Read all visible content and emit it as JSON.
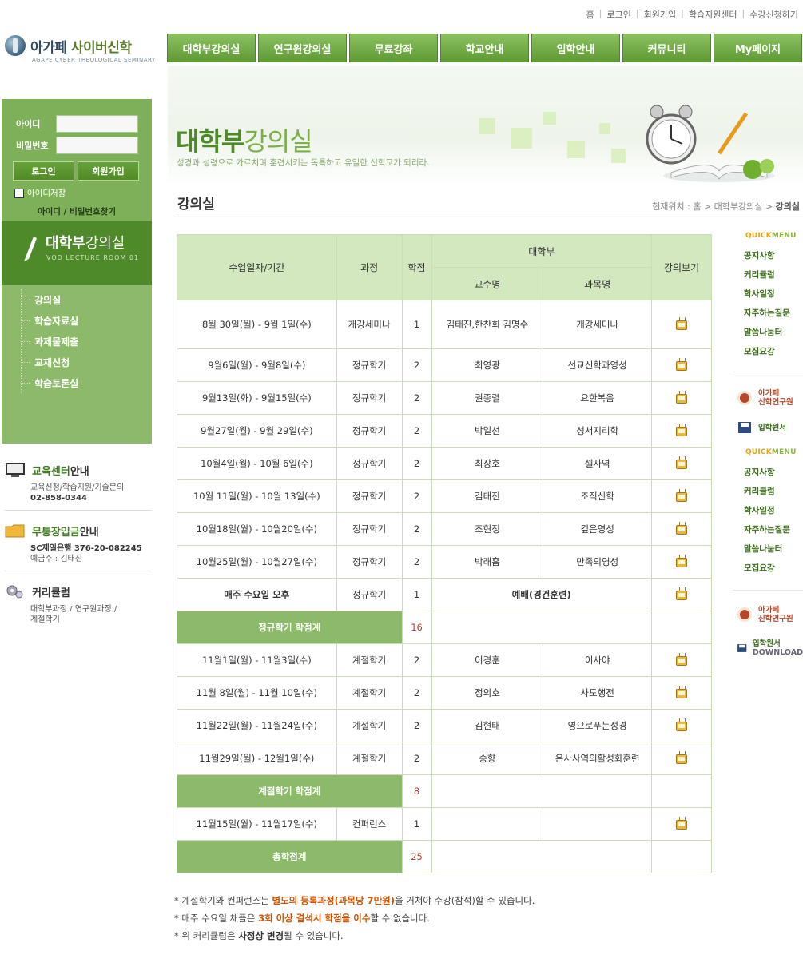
{
  "top_links": [
    "홈",
    "로그인",
    "회원가입",
    "학습지원센터",
    "수강신청하기"
  ],
  "logo": {
    "name_a": "아가페",
    "name_b": "사이버신학",
    "sub": "AGAPE CYBER THEOLOGICAL SEMINARY"
  },
  "gnb": [
    "대학부강의실",
    "연구원강의실",
    "무료강좌",
    "학교안내",
    "입학안내",
    "커뮤니티",
    "My페이지"
  ],
  "banner": {
    "title_bold": "대학부",
    "title_rest": "강의실",
    "subtitle": "성경과 성령으로 가르치며 훈련시키는 독특하고 유일한 신학교가 되리라."
  },
  "section": {
    "title": "강의실",
    "breadcrumb_prefix": "현재위치 : 홈 > 대학부강의실 > ",
    "breadcrumb_current": "강의실"
  },
  "login": {
    "id_label": "아이디",
    "pw_label": "비밀번호",
    "login_btn": "로그인",
    "join_btn": "회원가입",
    "save_id": "아이디저장",
    "find": "아이디 / 비밀번호찾기"
  },
  "vod": {
    "title_bold": "대학부",
    "title_rest": "강의실",
    "sub": "VOD LECTURE ROOM 01"
  },
  "left_menu": [
    "강의실",
    "학습자료실",
    "과제물제출",
    "교재신청",
    "학습토론실"
  ],
  "info": {
    "edu_head_bold": "교육센터",
    "edu_head_rest": "안내",
    "edu_desc": "교육신청/학습지원/기술문의",
    "edu_phone": "02-858-0344",
    "bank_head_bold": "무통장입금",
    "bank_head_rest": "안내",
    "bank_acct": "SC제일은행 376-20-082245",
    "bank_owner": "예금주 : 김태진",
    "curr_head": "커리큘럼",
    "curr_desc1": "대학부과정 / 연구원과정 /",
    "curr_desc2": "계절학기"
  },
  "quick": {
    "head_a": "QUICK",
    "head_b": "MENU",
    "items": [
      "공지사항",
      "커리큘럼",
      "학사일정",
      "자주하는질문",
      "말씀나눔터",
      "모집요강"
    ],
    "promo1_a": "아가페",
    "promo1_b": "신학연구원",
    "promo2": "입학원서",
    "items2": [
      "공지사항",
      "커리큘럼",
      "학사일정",
      "자주하는질문",
      "말씀나눔터",
      "모집요강"
    ],
    "promo3_a": "아가페",
    "promo3_b": "신학연구원",
    "promo4_a": "입학원서",
    "promo4_b": "DOWNLOAD"
  },
  "table": {
    "h_date": "수업일자/기간",
    "h_course": "과정",
    "h_credit": "학점",
    "h_dept": "대학부",
    "h_prof": "교수명",
    "h_subject": "과목명",
    "h_view": "강의보기",
    "rows1": [
      {
        "date": "8월 30일(월) - 9월 1일(수)",
        "course": "개강세미나",
        "credit": "1",
        "prof": "김태진,한찬희 김명수",
        "subject": "개강세미나"
      },
      {
        "date": "9월6일(월) - 9월8일(수)",
        "course": "정규학기",
        "credit": "2",
        "prof": "최영광",
        "subject": "선교신학과영성"
      },
      {
        "date": "9월13일(화) - 9월15일(수)",
        "course": "정규학기",
        "credit": "2",
        "prof": "권종렬",
        "subject": "요한복음"
      },
      {
        "date": "9월27일(월) - 9월 29일(수)",
        "course": "정규학기",
        "credit": "2",
        "prof": "박일선",
        "subject": "성서지리학"
      },
      {
        "date": "10월4일(월) - 10월 6일(수)",
        "course": "정규학기",
        "credit": "2",
        "prof": "최장호",
        "subject": "셀사역"
      },
      {
        "date": "10월 11일(월) - 10월 13일(수)",
        "course": "정규학기",
        "credit": "2",
        "prof": "김태진",
        "subject": "조직신학"
      },
      {
        "date": "10월18일(월) - 10월20일(수)",
        "course": "정규학기",
        "credit": "2",
        "prof": "조현정",
        "subject": "깊은영성"
      },
      {
        "date": "10월25일(월) - 10월27일(수)",
        "course": "정규학기",
        "credit": "2",
        "prof": "박래흠",
        "subject": "만족의영성"
      }
    ],
    "wed_date": "매주 수요일 오후",
    "wed_course": "정규학기",
    "wed_credit": "1",
    "wed_subject": "예배(경건훈련)",
    "sum1_label": "정규학기 학점계",
    "sum1_value": "16",
    "rows2": [
      {
        "date": "11월1일(월) - 11월3일(수)",
        "course": "계절학기",
        "credit": "2",
        "prof": "이경훈",
        "subject": "이사야"
      },
      {
        "date": "11월 8일(월) - 11월 10일(수)",
        "course": "계절학기",
        "credit": "2",
        "prof": "정의호",
        "subject": "사도행전"
      },
      {
        "date": "11월22일(월) - 11월24일(수)",
        "course": "계절학기",
        "credit": "2",
        "prof": "김현태",
        "subject": "영으로푸는성경"
      },
      {
        "date": "11월29일(월) - 12월1일(수)",
        "course": "계절학기",
        "credit": "2",
        "prof": "송향",
        "subject": "은사사역의활성화훈련"
      }
    ],
    "sum2_label": "계절학기 학점계",
    "sum2_value": "8",
    "conf_date": "11월15일(월) - 11월17일(수)",
    "conf_course": "컨퍼런스",
    "conf_credit": "1",
    "total_label": "총학점계",
    "total_value": "25"
  },
  "notes": {
    "n1_a": "* 계절학기와 컨퍼런스는 ",
    "n1_hl": "별도의 등록과정(과목당 7만원)",
    "n1_b": "을 거쳐야 수강(참석)할 수 있습니다.",
    "n2_a": "* 매주 수요일 채플은 ",
    "n2_hl": "3회 이상 결석시 학점을 이수",
    "n2_b": "할 수 없습니다.",
    "n3_a": "* 위 커리큘럼은 ",
    "n3_bk": "사정상 변경",
    "n3_b": "될 수 있습니다."
  }
}
